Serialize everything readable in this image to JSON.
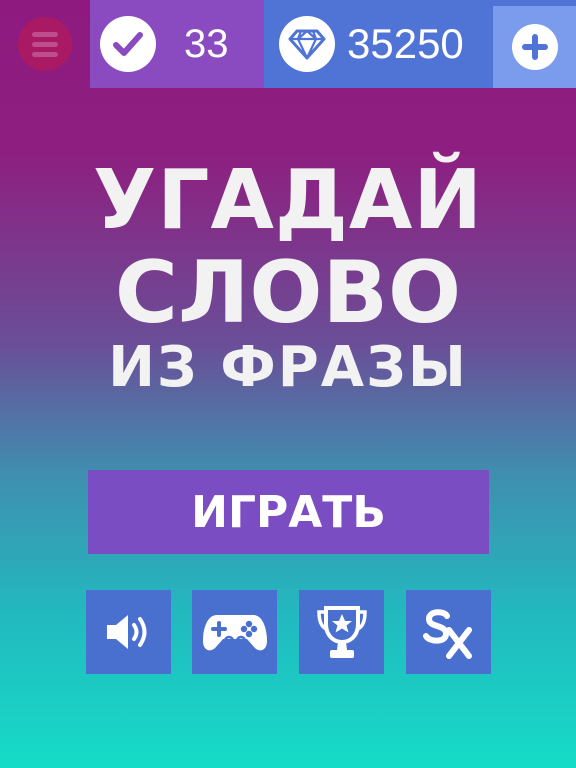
{
  "header": {
    "menu_icon": "hamburger-menu-icon",
    "score": "33",
    "score_icon": "checkmark-icon",
    "gems": "35250",
    "gems_icon": "diamond-icon",
    "add_icon": "plus-icon"
  },
  "title": {
    "line1": "УГАДАЙ",
    "line2": "СЛОВО",
    "line3": "ИЗ ФРАЗЫ"
  },
  "play_button": {
    "label": "ИГРАТЬ"
  },
  "bottom_buttons": [
    {
      "icon": "speaker-icon"
    },
    {
      "icon": "gamepad-icon"
    },
    {
      "icon": "trophy-icon"
    },
    {
      "icon": "sx-logo-icon"
    }
  ],
  "colors": {
    "score_bg": "#8a4bc0",
    "gems_bg": "#4f74d5",
    "add_bg": "#7b9cec",
    "play_bg": "#7b4dc2",
    "icon_btn_bg": "#4a70cf"
  }
}
